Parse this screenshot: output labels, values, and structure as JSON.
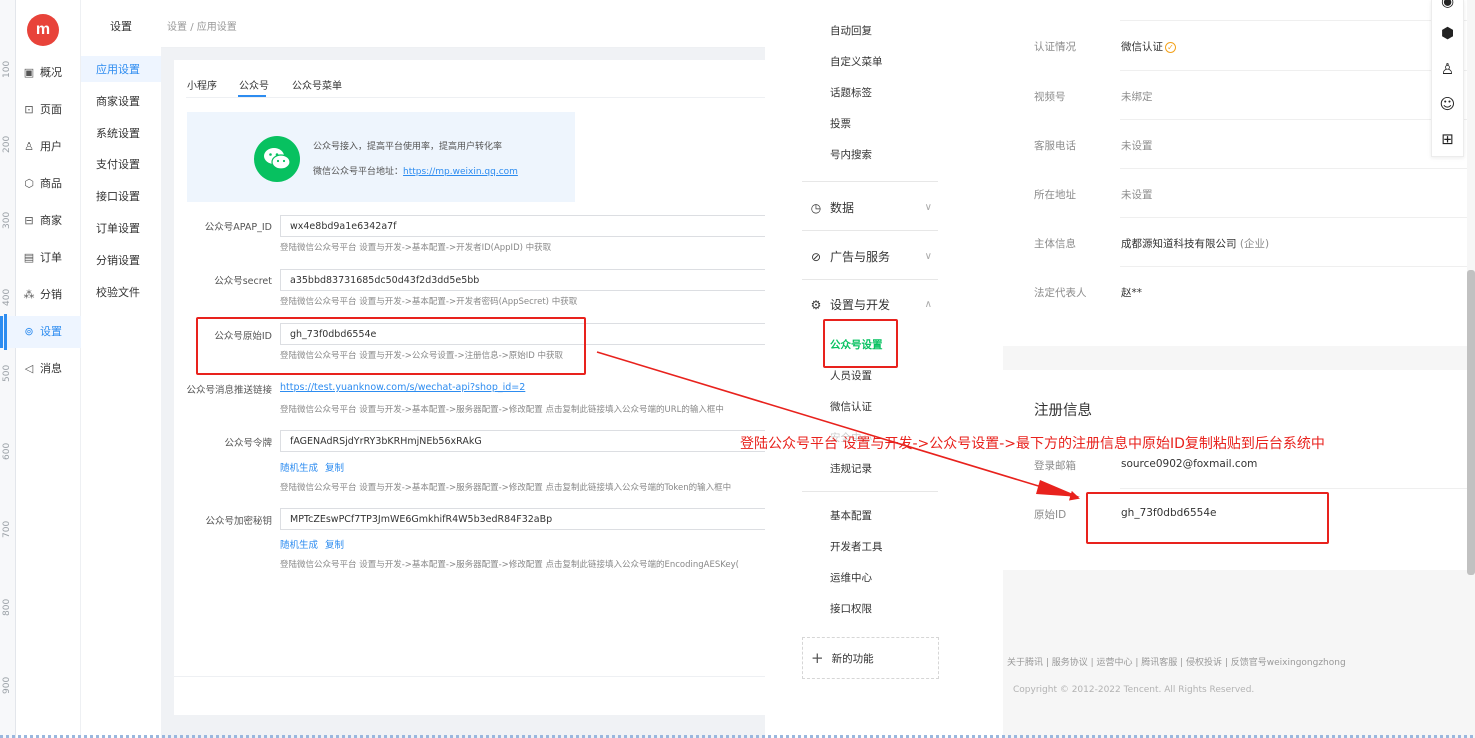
{
  "ruler": {
    "marks": [
      "100",
      "200",
      "300",
      "400",
      "500",
      "600",
      "700",
      "800",
      "900"
    ]
  },
  "nav": {
    "logo_text": "m",
    "items": [
      {
        "icon": "dashboard-icon",
        "glyph": "▣",
        "label": "概况"
      },
      {
        "icon": "page-icon",
        "glyph": "⊡",
        "label": "页面"
      },
      {
        "icon": "user-icon",
        "glyph": "♙",
        "label": "用户"
      },
      {
        "icon": "goods-icon",
        "glyph": "⬡",
        "label": "商品"
      },
      {
        "icon": "merchant-icon",
        "glyph": "⊟",
        "label": "商家"
      },
      {
        "icon": "order-icon",
        "glyph": "▤",
        "label": "订单"
      },
      {
        "icon": "distribution-icon",
        "glyph": "⁂",
        "label": "分销"
      },
      {
        "icon": "settings-icon",
        "glyph": "⊚",
        "label": "设置"
      },
      {
        "icon": "message-icon",
        "glyph": "◁",
        "label": "消息"
      }
    ]
  },
  "submenu": {
    "title": "设置",
    "items": [
      "应用设置",
      "商家设置",
      "系统设置",
      "支付设置",
      "接口设置",
      "订单设置",
      "分销设置",
      "校验文件"
    ]
  },
  "breadcrumb": {
    "root": "设置",
    "sep": "/",
    "current": "应用设置"
  },
  "tabs": [
    "小程序",
    "公众号",
    "公众号菜单"
  ],
  "info": {
    "desc": "公众号接入，提高平台使用率，提高用户转化率",
    "link_prefix": "微信公众号平台地址：",
    "link_text": "https://mp.weixin.qq.com"
  },
  "form": {
    "appid": {
      "label": "公众号APAP_ID",
      "value": "wx4e8bd9a1e6342a7f",
      "hint": "登陆微信公众号平台 设置与开发->基本配置->开发者ID(AppID) 中获取"
    },
    "secret": {
      "label": "公众号secret",
      "value": "a35bbd83731685dc50d43f2d3dd5e5bb",
      "hint": "登陆微信公众号平台 设置与开发->基本配置->开发者密码(AppSecret) 中获取"
    },
    "original_id": {
      "label": "公众号原始ID",
      "value": "gh_73f0dbd6554e",
      "hint": "登陆微信公众号平台 设置与开发->公众号设置->注册信息->原始ID 中获取"
    },
    "push_link": {
      "label": "公众号消息推送链接",
      "value": "https://test.yuanknow.com/s/wechat-api?shop_id=2",
      "hint": "登陆微信公众号平台 设置与开发->基本配置->服务器配置->修改配置 点击复制此链接填入公众号端的URL的输入框中"
    },
    "token": {
      "label": "公众号令牌",
      "value": "fAGENAdRSjdYrRY3bKRHmjNEb56xRAkG",
      "action_generate": "随机生成",
      "action_copy": "复制",
      "hint": "登陆微信公众号平台 设置与开发->基本配置->服务器配置->修改配置 点击复制此链接填入公众号端的Token的输入框中"
    },
    "aes_key": {
      "label": "公众号加密秘钥",
      "value": "MPTcZEswPCf7TP3JmWE6GmkhifR4W5b3edR84F32aBp",
      "action_generate": "随机生成",
      "action_copy": "复制",
      "hint": "登陆微信公众号平台 设置与开发->基本配置->服务器配置->修改配置 点击复制此链接填入公众号端的EncodingAESKey("
    }
  },
  "wx_menu": {
    "top_items": [
      "自动回复",
      "自定义菜单",
      "话题标签",
      "投票",
      "号内搜索"
    ],
    "group_data": "数据",
    "group_ads": "广告与服务",
    "group_dev": "设置与开发",
    "dev_items": [
      "公众号设置",
      "人员设置",
      "微信认证",
      "安全中心",
      "违规记录"
    ],
    "dev_items2": [
      "基本配置",
      "开发者工具",
      "运维中心",
      "接口权限"
    ],
    "new_feature": "新的功能"
  },
  "wx_info": {
    "auth_label": "认证情况",
    "auth_value": "微信认证",
    "channel_label": "视频号",
    "channel_value": "未绑定",
    "phone_label": "客服电话",
    "phone_value": "未设置",
    "address_label": "所在地址",
    "address_value": "未设置",
    "entity_label": "主体信息",
    "entity_value": "成都源知道科技有限公司",
    "entity_type": "(企业)",
    "legal_label": "法定代表人",
    "legal_value": "赵**",
    "reg_title": "注册信息",
    "email_label": "登录邮箱",
    "email_value": "source0902@foxmail.com",
    "origid_label": "原始ID",
    "origid_value": "gh_73f0dbd6554e"
  },
  "wx_footer": {
    "links": "关于腾讯 | 服务协议 | 运营中心 | 腾讯客服 | 侵权投诉 | 反馈官号weixingongzhong",
    "copyright": "Copyright © 2012-2022 Tencent. All Rights Reserved."
  },
  "annotation": "登陆公众号平台 设置与开发->公众号设置->最下方的注册信息中原始ID复制粘贴到后台系统中",
  "colors": {
    "accent": "#2d8cf0",
    "wechat_green": "#07c160",
    "annotation_red": "#e8221d"
  }
}
